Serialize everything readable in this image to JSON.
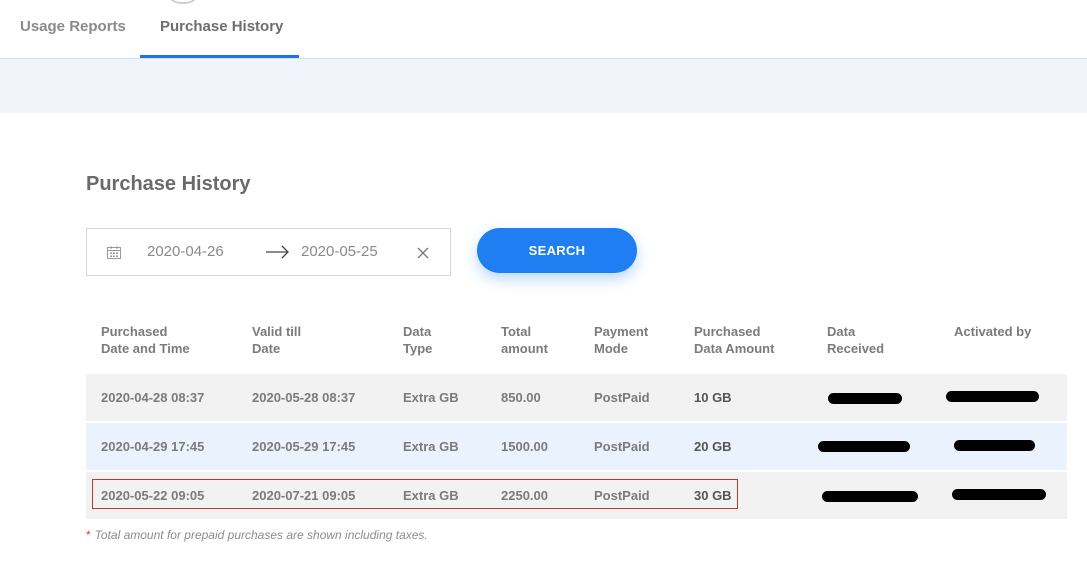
{
  "tabs": [
    {
      "label": "Usage Reports"
    },
    {
      "label": "Purchase History",
      "active": true
    }
  ],
  "accent_color": "#1f7ef2",
  "page_title": "Purchase History",
  "date_range": {
    "from": "2020-04-26",
    "to": "2020-05-25"
  },
  "search_label": "SEARCH",
  "table": {
    "headers": [
      {
        "line1": "Purchased",
        "line2": "Date and Time"
      },
      {
        "line1": "Valid till",
        "line2": "Date"
      },
      {
        "line1": "Data",
        "line2": "Type"
      },
      {
        "line1": "Total",
        "line2": "amount"
      },
      {
        "line1": "Payment",
        "line2": "Mode"
      },
      {
        "line1": "Purchased",
        "line2": "Data Amount"
      },
      {
        "line1": "Data",
        "line2": "Received"
      },
      {
        "line1": "Activated by",
        "line2": ""
      }
    ],
    "rows": [
      {
        "purchased": "2020-04-28 08:37",
        "valid_till": "2020-05-28 08:37",
        "type": "Extra GB",
        "amount": "850.00",
        "mode": "PostPaid",
        "data_amount": "10 GB"
      },
      {
        "purchased": "2020-04-29 17:45",
        "valid_till": "2020-05-29 17:45",
        "type": "Extra GB",
        "amount": "1500.00",
        "mode": "PostPaid",
        "data_amount": "20 GB"
      },
      {
        "purchased": "2020-05-22 09:05",
        "valid_till": "2020-07-21 09:05",
        "type": "Extra GB",
        "amount": "2250.00",
        "mode": "PostPaid",
        "data_amount": "30 GB"
      }
    ]
  },
  "note": {
    "star": "*",
    "text": "Total amount for prepaid purchases are shown including taxes."
  }
}
